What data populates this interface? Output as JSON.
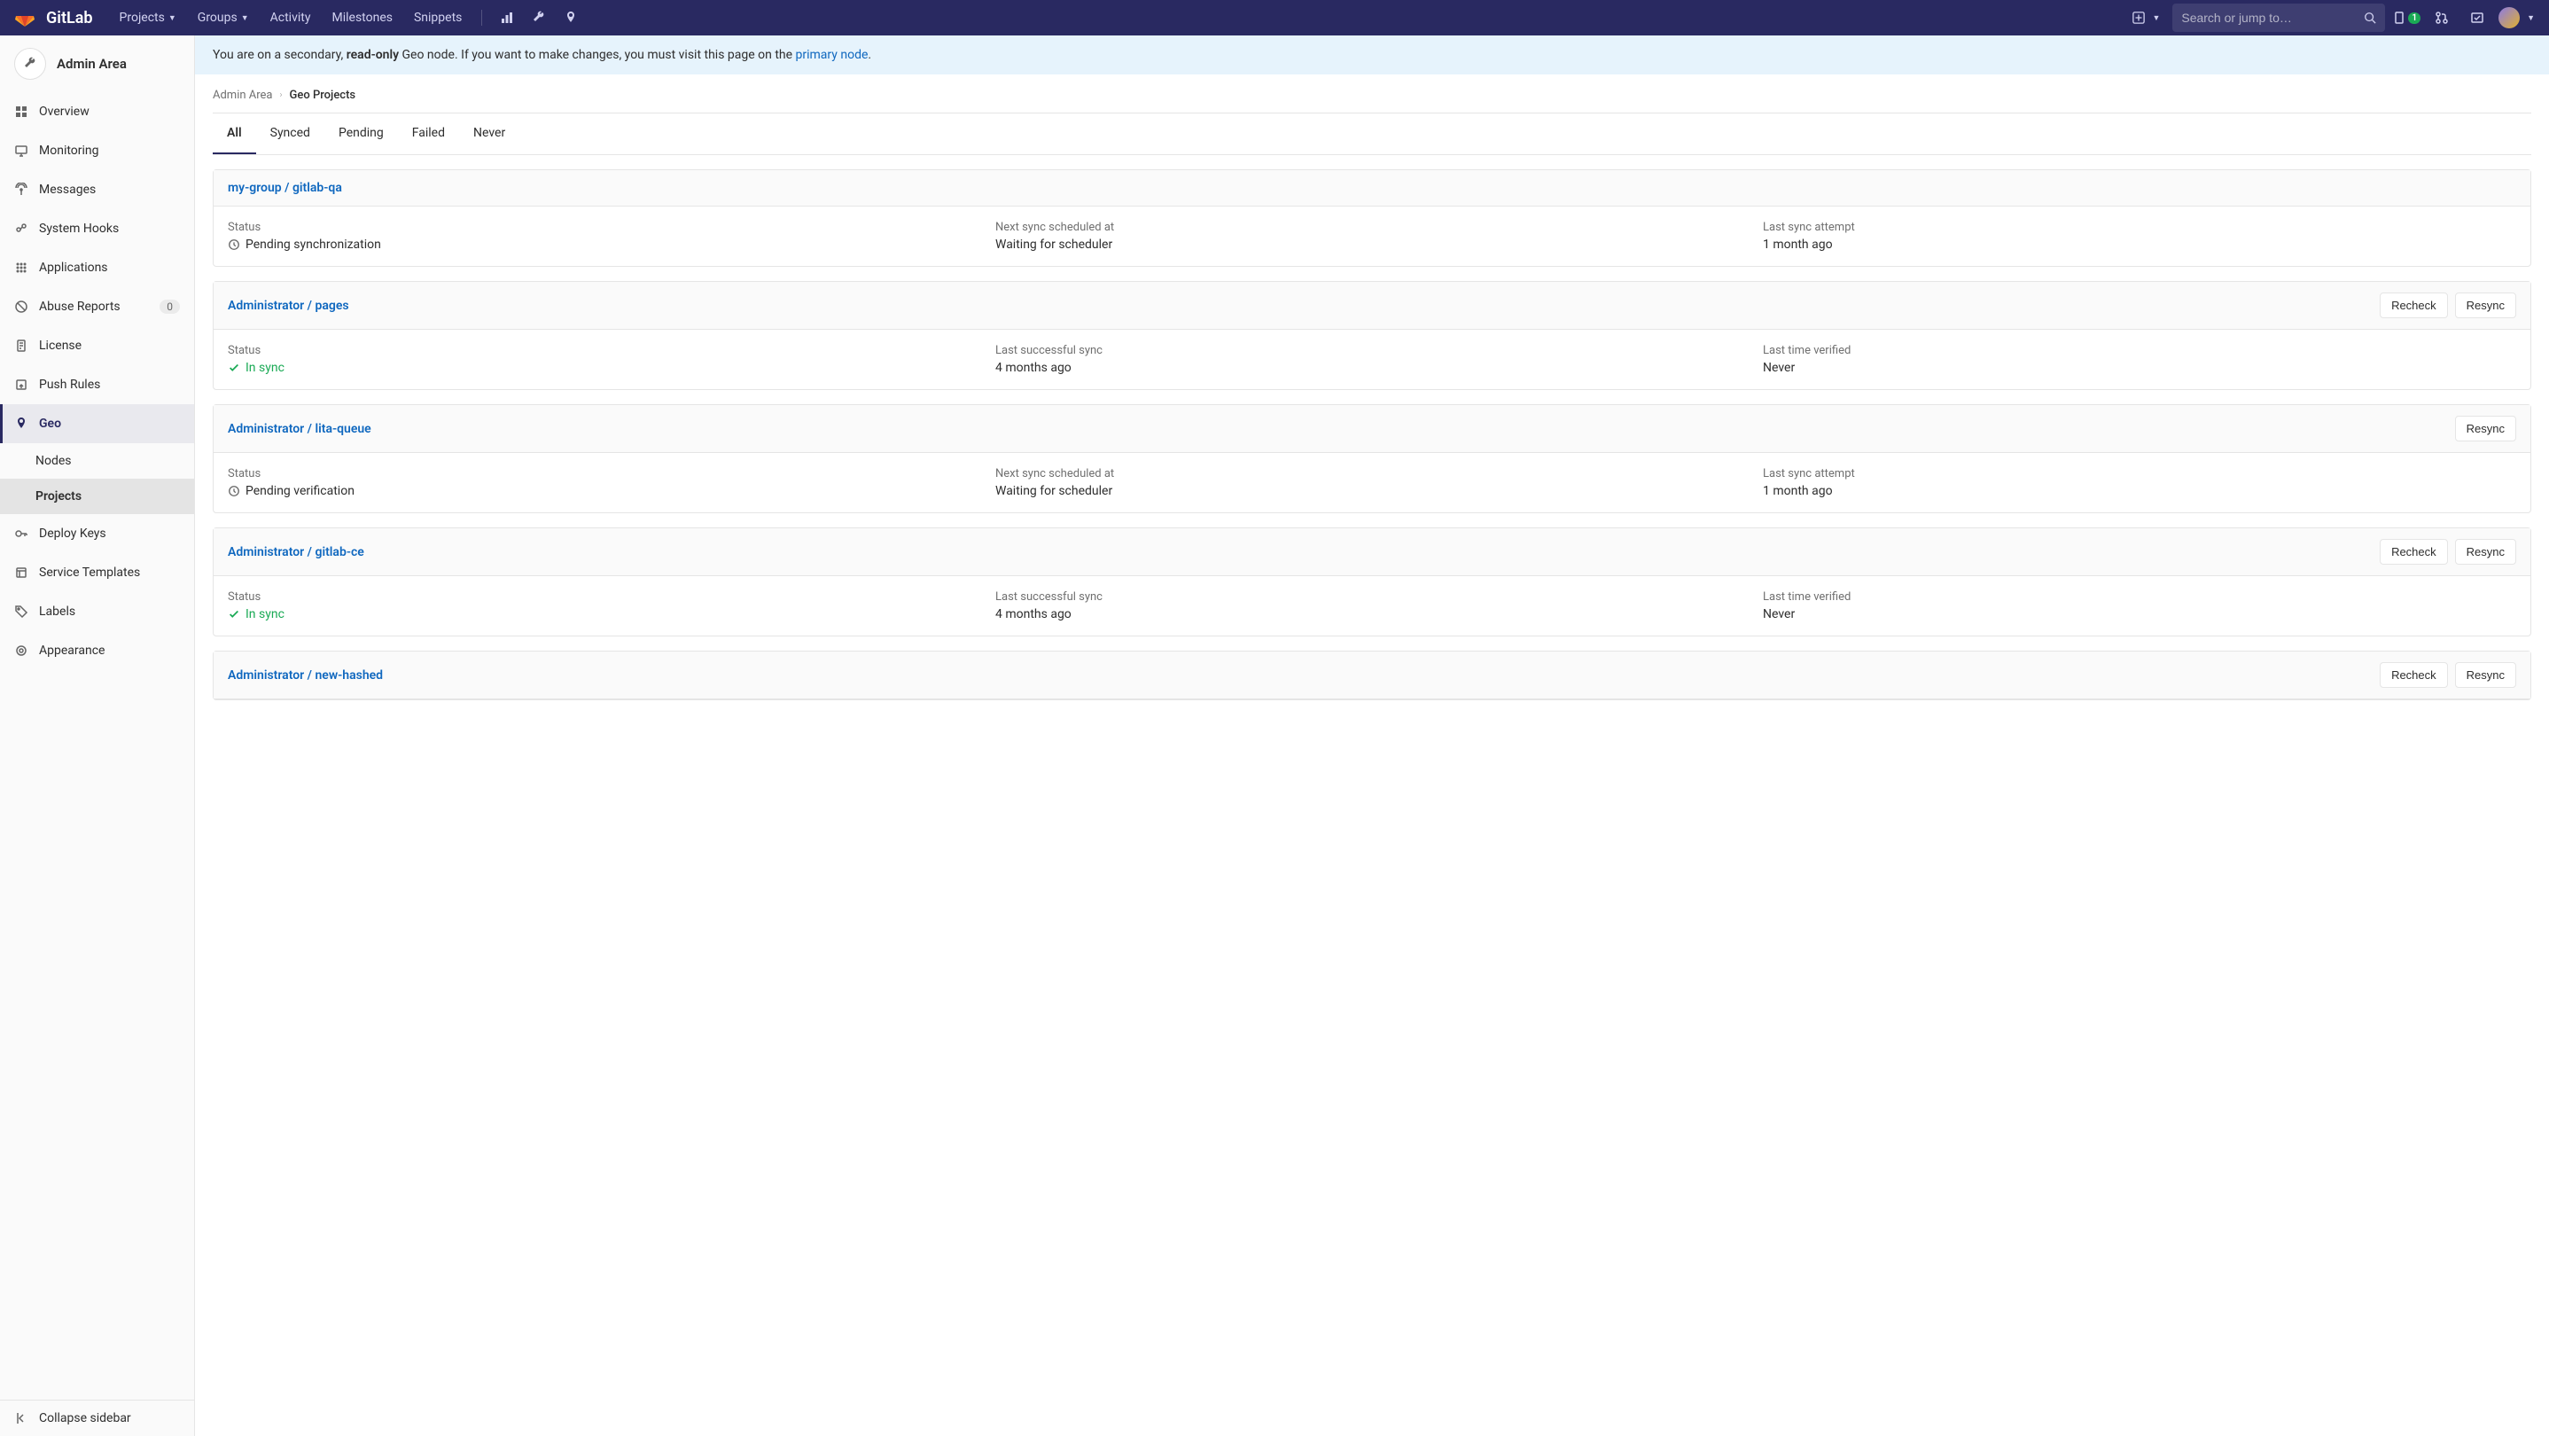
{
  "navbar": {
    "brand": "GitLab",
    "items": [
      {
        "label": "Projects",
        "dropdown": true
      },
      {
        "label": "Groups",
        "dropdown": true
      },
      {
        "label": "Activity"
      },
      {
        "label": "Milestones"
      },
      {
        "label": "Snippets"
      }
    ],
    "search_placeholder": "Search or jump to…",
    "issue_badge": "1"
  },
  "sidebar": {
    "title": "Admin Area",
    "items": [
      {
        "icon": "dashboard",
        "label": "Overview"
      },
      {
        "icon": "monitor",
        "label": "Monitoring"
      },
      {
        "icon": "broadcast",
        "label": "Messages"
      },
      {
        "icon": "hook",
        "label": "System Hooks"
      },
      {
        "icon": "apps",
        "label": "Applications"
      },
      {
        "icon": "abuse",
        "label": "Abuse Reports",
        "badge": "0"
      },
      {
        "icon": "license",
        "label": "License"
      },
      {
        "icon": "push",
        "label": "Push Rules"
      },
      {
        "icon": "geo",
        "label": "Geo",
        "active": true,
        "children": [
          {
            "label": "Nodes"
          },
          {
            "label": "Projects",
            "active": true
          }
        ]
      },
      {
        "icon": "key",
        "label": "Deploy Keys"
      },
      {
        "icon": "template",
        "label": "Service Templates"
      },
      {
        "icon": "labels",
        "label": "Labels"
      },
      {
        "icon": "appearance",
        "label": "Appearance"
      }
    ],
    "collapse": "Collapse sidebar"
  },
  "banner": {
    "pre": "You are on a secondary, ",
    "strong": "read-only",
    "mid": " Geo node. If you want to make changes, you must visit this page on the ",
    "link": "primary node",
    "post": "."
  },
  "breadcrumb": {
    "root": "Admin Area",
    "current": "Geo Projects"
  },
  "tabs": [
    "All",
    "Synced",
    "Pending",
    "Failed",
    "Never"
  ],
  "active_tab": 0,
  "projects": [
    {
      "title": "my-group / gitlab-qa",
      "actions": [],
      "fields": [
        {
          "label": "Status",
          "value": "Pending synchronization",
          "icon": "clock"
        },
        {
          "label": "Next sync scheduled at",
          "value": "Waiting for scheduler"
        },
        {
          "label": "Last sync attempt",
          "value": "1 month ago"
        }
      ]
    },
    {
      "title": "Administrator / pages",
      "actions": [
        "Recheck",
        "Resync"
      ],
      "fields": [
        {
          "label": "Status",
          "value": "In sync",
          "icon": "check",
          "green": true
        },
        {
          "label": "Last successful sync",
          "value": "4 months ago"
        },
        {
          "label": "Last time verified",
          "value": "Never"
        }
      ]
    },
    {
      "title": "Administrator / lita-queue",
      "actions": [
        "Resync"
      ],
      "fields": [
        {
          "label": "Status",
          "value": "Pending verification",
          "icon": "clock"
        },
        {
          "label": "Next sync scheduled at",
          "value": "Waiting for scheduler"
        },
        {
          "label": "Last sync attempt",
          "value": "1 month ago"
        }
      ]
    },
    {
      "title": "Administrator / gitlab-ce",
      "actions": [
        "Recheck",
        "Resync"
      ],
      "fields": [
        {
          "label": "Status",
          "value": "In sync",
          "icon": "check",
          "green": true
        },
        {
          "label": "Last successful sync",
          "value": "4 months ago"
        },
        {
          "label": "Last time verified",
          "value": "Never"
        }
      ]
    },
    {
      "title": "Administrator / new-hashed",
      "actions": [
        "Recheck",
        "Resync"
      ],
      "fields": []
    }
  ],
  "buttons": {
    "recheck": "Recheck",
    "resync": "Resync"
  }
}
